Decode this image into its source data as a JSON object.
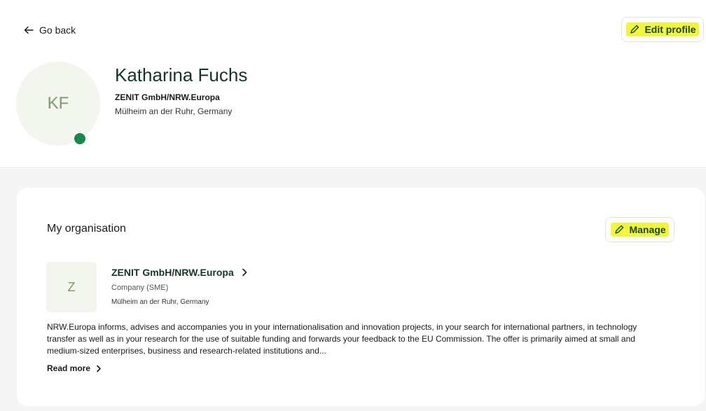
{
  "nav": {
    "go_back_label": "Go back"
  },
  "profile": {
    "edit_label": "Edit profile",
    "initials": "KF",
    "name": "Katharina Fuchs",
    "organisation": "ZENIT GmbH/NRW.Europa",
    "location": "Mülheim an der Ruhr, Germany",
    "status": "online"
  },
  "organisation_section": {
    "title": "My organisation",
    "manage_label": "Manage",
    "org": {
      "initial": "Z",
      "name": "ZENIT GmbH/NRW.Europa",
      "type": "Company (SME)",
      "location": "Mülheim an der Ruhr, Germany",
      "description": "NRW.Europa informs, advises and accompanies you in your internationalisation and innovation projects, in your search for international partners, in technology transfer as well as in your research for the use of suitable funding and forwards your feedback to the EU Commission. The offer is primarily aimed at small and medium-sized enterprises, business and research-related institutions and...",
      "read_more_label": "Read more"
    }
  },
  "colors": {
    "accent_green": "#17462f",
    "status_green": "#148a4a",
    "highlight": "#f2f53c",
    "avatar_bg": "#f2f6ef",
    "section_bg": "#f4f5f4"
  }
}
